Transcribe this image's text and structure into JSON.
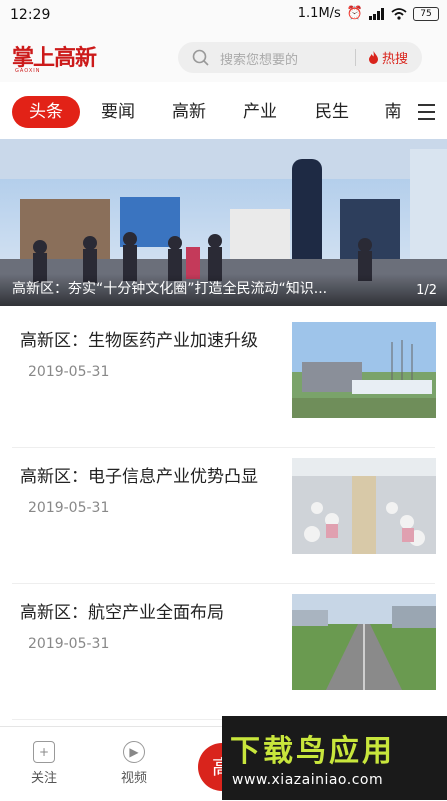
{
  "status_bar": {
    "time": "12:29",
    "net_speed": "1.1M/s",
    "battery": "75"
  },
  "header": {
    "logo_text": "掌上高新",
    "logo_sub": "GAOXIN",
    "search_placeholder": "搜索您想要的",
    "hot_label": "热搜"
  },
  "tabs": [
    {
      "label": "头条",
      "active": true
    },
    {
      "label": "要闻"
    },
    {
      "label": "高新"
    },
    {
      "label": "产业"
    },
    {
      "label": "民生"
    },
    {
      "label": "南"
    }
  ],
  "banner": {
    "caption": "高新区：夯实“十分钟文化圈”打造全民流动“知识...",
    "pager": "1/2"
  },
  "news": [
    {
      "title": "高新区：生物医药产业加速升级",
      "date": "2019-05-31"
    },
    {
      "title": "高新区：电子信息产业优势凸显",
      "date": "2019-05-31"
    },
    {
      "title": "高新区：航空产业全面布局",
      "date": "2019-05-31"
    }
  ],
  "bottom_nav": {
    "follow": "关注",
    "video": "视频",
    "fab_glyph": "高"
  },
  "watermark": {
    "title": "下载鸟应用",
    "url": "www.xiazainiao.com"
  },
  "colors": {
    "accent": "#e22217",
    "watermark_green": "#c8e63c"
  }
}
